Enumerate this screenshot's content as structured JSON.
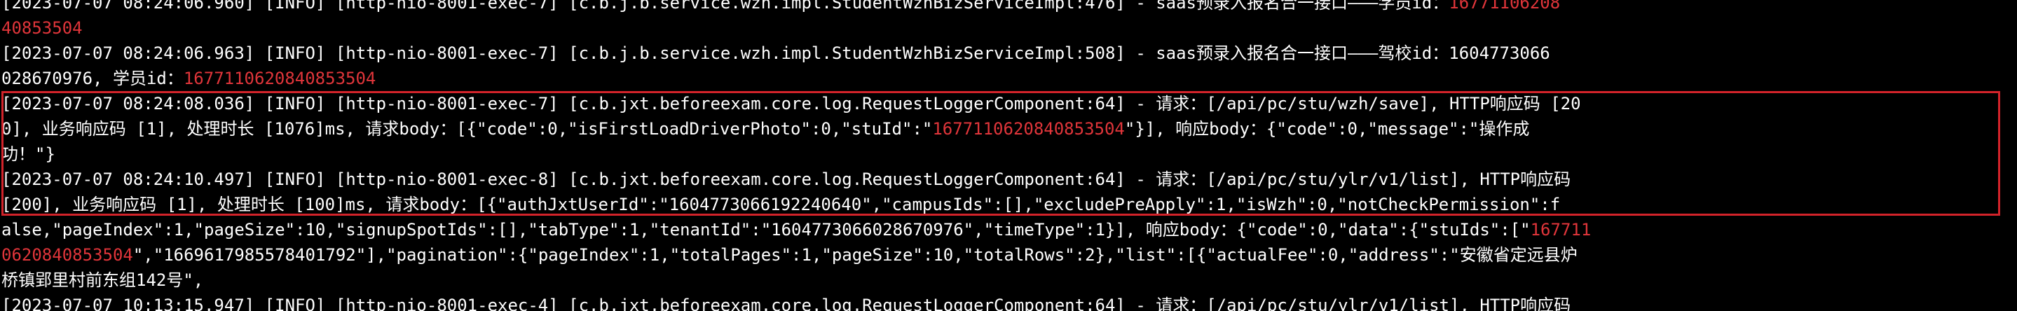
{
  "terminal": {
    "lines": [
      {
        "text": "[2023-07-07 08:24:06.960] [INFO] [http-nio-8001-exec-7] [c.b.j.b.service.wzh.impl.StudentWzhBizServiceImpl:476] - saas预录入报名合一接口———学员id：",
        "hl": "16771106208"
      },
      {
        "text": "",
        "hl": "40853504"
      },
      {
        "text": "[2023-07-07 08:24:06.963] [INFO] [http-nio-8001-exec-7] [c.b.j.b.service.wzh.impl.StudentWzhBizServiceImpl:508] - saas预录入报名合一接口———驾校id：1604773066",
        "hl": ""
      },
      {
        "text": "028670976, 学员id：",
        "hl": "1677110620840853504"
      },
      {
        "text": "[2023-07-07 08:24:08.036] [INFO] [http-nio-8001-exec-7] [c.b.jxt.beforeexam.core.log.RequestLoggerComponent:64] - 请求：[/api/pc/stu/wzh/save], HTTP响应码 [20",
        "hl": ""
      },
      {
        "text": "0], 业务响应码 [1], 处理时长 [1076]ms, 请求body：[{\"code\":0,\"isFirstLoadDriverPhoto\":0,\"stuId\":\"",
        "hl": "1677110620840853504",
        "tail": "\"}], 响应body：{\"code\":0,\"message\":\"操作成"
      },
      {
        "text": "功！\"}",
        "hl": ""
      },
      {
        "text": "[2023-07-07 08:24:10.497] [INFO] [http-nio-8001-exec-8] [c.b.jxt.beforeexam.core.log.RequestLoggerComponent:64] - 请求：[/api/pc/stu/ylr/v1/list], HTTP响应码",
        "hl": ""
      },
      {
        "text": "[200], 业务响应码 [1], 处理时长 [100]ms, 请求body：[{\"authJxtUserId\":\"1604773066192240640\",\"campusIds\":[],\"excludePreApply\":1,\"isWzh\":0,\"notCheckPermission\":f",
        "hl": ""
      },
      {
        "text": "alse,\"pageIndex\":1,\"pageSize\":10,\"signupSpotIds\":[],\"tabType\":1,\"tenantId\":\"1604773066028670976\",\"timeType\":1}], 响应body：{\"code\":0,\"data\":{\"stuIds\":[\"",
        "hl": "167711"
      },
      {
        "text": "",
        "hl": "0620840853504",
        "tail": "\",\"1669617985578401792\"],\"pagination\":{\"pageIndex\":1,\"totalPages\":1,\"pageSize\":10,\"totalRows\":2},\"list\":[{\"actualFee\":0,\"address\":\"安徽省定远县炉"
      },
      {
        "text": "桥镇郢里村前东组142号\",",
        "hl": ""
      },
      {
        "text": "[2023-07-07 10:13:15.947] [INFO] [http-nio-8001-exec-4] [c.b.jxt.beforeexam.core.log.RequestLoggerComponent:64] - 请求：[/api/pc/stu/ylr/v1/list], HTTP响应码",
        "hl": ""
      }
    ]
  }
}
